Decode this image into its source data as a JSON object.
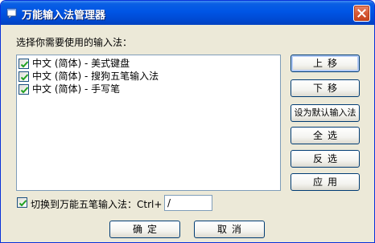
{
  "window": {
    "title": "万能输入法管理器"
  },
  "prompt_label": "选择你需要使用的输入法：",
  "list": {
    "items": [
      {
        "label": "中文 (简体) - 美式键盘",
        "checked": true
      },
      {
        "label": "中文 (简体) - 搜狗五笔输入法",
        "checked": true
      },
      {
        "label": "中文 (简体) - 手写笔",
        "checked": true
      }
    ]
  },
  "side_buttons": {
    "move_up": "上移",
    "move_down": "下移",
    "set_default": "设为默认输入法",
    "select_all": "全选",
    "invert": "反选",
    "apply": "应用"
  },
  "hotkey": {
    "checkbox_label": "切换到万能五笔输入法：Ctrl+",
    "checked": true,
    "key_value": "/"
  },
  "footer": {
    "ok": "确定",
    "cancel": "取消"
  },
  "colors": {
    "titlebar": "#0055e5",
    "dialog_bg": "#ece9d8",
    "check": "#21a121"
  }
}
